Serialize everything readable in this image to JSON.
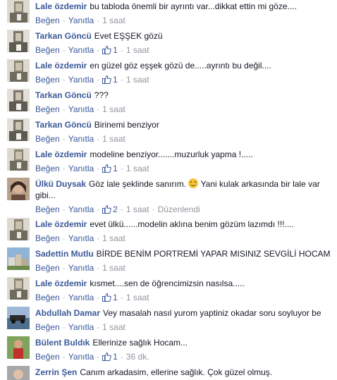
{
  "labels": {
    "like": "Beğen",
    "reply": "Yanıtla",
    "separator": "·"
  },
  "colors": {
    "author": "#3b5998",
    "meta": "#90949c",
    "text": "#141823"
  },
  "comments": [
    {
      "author": "Lale özdemir",
      "text": "bu tabloda önemli bir ayrıntı var...dikkat ettin mi göze....",
      "likes": "",
      "time": "1 saat",
      "edited": "",
      "avatar": "lale"
    },
    {
      "author": "Tarkan Göncü",
      "text": "Evet EŞŞEK gözü",
      "likes": "1",
      "time": "1 saat",
      "edited": "",
      "avatar": "tarkan"
    },
    {
      "author": "Lale özdemir",
      "text": "en güzel göz eşşek gözü de.....ayrıntı bu değil....",
      "likes": "1",
      "time": "1 saat",
      "edited": "",
      "avatar": "lale"
    },
    {
      "author": "Tarkan Göncü",
      "text": "???",
      "likes": "",
      "time": "1 saat",
      "edited": "",
      "avatar": "tarkan"
    },
    {
      "author": "Tarkan Göncü",
      "text": "Birinemi benziyor",
      "likes": "",
      "time": "1 saat",
      "edited": "",
      "avatar": "tarkan"
    },
    {
      "author": "Lale özdemir",
      "text": "modeline benziyor.......muzurluk yapma !.....",
      "likes": "1",
      "time": "1 saat",
      "edited": "",
      "avatar": "lale"
    },
    {
      "author": "Ülkü Duysak",
      "text": "Göz lale şeklinde sanırım.",
      "text2": "Yani kulak arkasında bir lale var gibi...",
      "likes": "2",
      "time": "1 saat",
      "edited": "Düzenlendi",
      "avatar": "ulku"
    },
    {
      "author": "Lale özdemir",
      "text": "evet ülkü......modelin aklına benim gözüm lazımdı !!!....",
      "likes": "",
      "time": "1 saat",
      "edited": "",
      "avatar": "lale"
    },
    {
      "author": "Sadettin Mutlu",
      "text": "BİRDE BENİM PORTREMİ YAPAR MISINIZ SEVGİLİ HOCAM",
      "likes": "",
      "time": "1 saat",
      "edited": "",
      "avatar": "sadettin"
    },
    {
      "author": "Lale özdemir",
      "text": "kısmet....sen de öğrencimizsin nasılsa.....",
      "likes": "1",
      "time": "1 saat",
      "edited": "",
      "avatar": "lale"
    },
    {
      "author": "Abdullah Damar",
      "text": "Vey masalah nasıl yurom yaptiniz okadar soru soyluyor be",
      "likes": "",
      "time": "1 saat",
      "edited": "",
      "avatar": "abdullah"
    },
    {
      "author": "Bülent Buldık",
      "text": "Ellerinize sağlık Hocam...",
      "likes": "1",
      "time": "36 dk.",
      "edited": "",
      "avatar": "bulent"
    },
    {
      "author": "Zerrin Şen",
      "text": "Canım arkadasim, ellerine sağlık. Çok güzel olmuş.",
      "likes": "",
      "time": "",
      "edited": "",
      "avatar": "zerrin"
    }
  ]
}
